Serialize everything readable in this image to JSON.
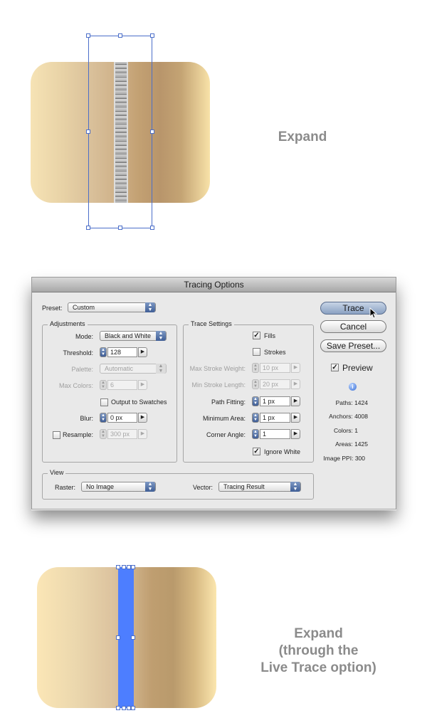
{
  "captions": {
    "top": "Expand",
    "bottom_line1": "Expand",
    "bottom_line2": "(through the",
    "bottom_line3": "Live Trace option)"
  },
  "dialog": {
    "title": "Tracing Options",
    "preset": {
      "label": "Preset:",
      "value": "Custom"
    },
    "adjustments": {
      "title": "Adjustments",
      "mode": {
        "label": "Mode:",
        "value": "Black and White"
      },
      "threshold": {
        "label": "Threshold:",
        "value": "128"
      },
      "palette": {
        "label": "Palette:",
        "value": "Automatic"
      },
      "max_colors": {
        "label": "Max Colors:",
        "value": "6"
      },
      "output_to_swatches": {
        "label": "Output to Swatches",
        "checked": false
      },
      "blur": {
        "label": "Blur:",
        "value": "0 px"
      },
      "resample": {
        "label": "Resample:",
        "value": "300 px",
        "checked": false
      }
    },
    "trace_settings": {
      "title": "Trace Settings",
      "fills": {
        "label": "Fills",
        "checked": true
      },
      "strokes": {
        "label": "Strokes",
        "checked": false
      },
      "max_stroke_weight": {
        "label": "Max Stroke Weight:",
        "value": "10 px"
      },
      "min_stroke_length": {
        "label": "Min Stroke Length:",
        "value": "20 px"
      },
      "path_fitting": {
        "label": "Path Fitting:",
        "value": "1 px"
      },
      "minimum_area": {
        "label": "Minimum Area:",
        "value": "1 px"
      },
      "corner_angle": {
        "label": "Corner Angle:",
        "value": "1"
      },
      "ignore_white": {
        "label": "Ignore White",
        "checked": true
      }
    },
    "view": {
      "title": "View",
      "raster": {
        "label": "Raster:",
        "value": "No Image"
      },
      "vector": {
        "label": "Vector:",
        "value": "Tracing Result"
      }
    },
    "buttons": {
      "trace": "Trace",
      "cancel": "Cancel",
      "save_preset": "Save Preset..."
    },
    "preview": {
      "label": "Preview",
      "checked": true
    },
    "stats": {
      "paths": "Paths: 1424",
      "anchors": "Anchors: 4008",
      "colors": "Colors: 1",
      "areas": "Areas: 1425",
      "image_ppi": "Image PPI: 300"
    }
  },
  "colors": {
    "selection": "#4b6ec9",
    "expanded_fill": "#4d7eff",
    "caption": "#8b8b8b"
  },
  "icons": [
    "info-icon",
    "cursor-arrow-icon",
    "checkmark-icon",
    "stepper-arrows-icon",
    "popup-arrows-icon",
    "flyout-triangle-icon"
  ]
}
